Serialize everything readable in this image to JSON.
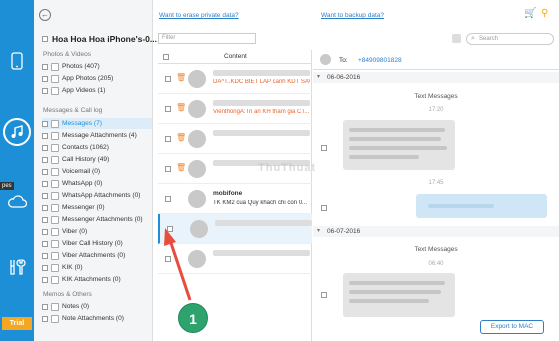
{
  "device_name": "Hoa Hoa Hoa iPhone's-0...",
  "sidebar": {
    "section_photos": "Photos & Videos",
    "section_messages": "Messages & Call log",
    "section_memos": "Memos & Others",
    "items": [
      {
        "label": "Photos (407)"
      },
      {
        "label": "App Photos (205)"
      },
      {
        "label": "App Videos (1)"
      },
      {
        "label": "Messages (7)"
      },
      {
        "label": "Message Attachments (4)"
      },
      {
        "label": "Contacts (1062)"
      },
      {
        "label": "Call History (49)"
      },
      {
        "label": "Voicemail (0)"
      },
      {
        "label": "WhatsApp (0)"
      },
      {
        "label": "WhatsApp Attachments (0)"
      },
      {
        "label": "Messenger (0)"
      },
      {
        "label": "Messenger Attachments (0)"
      },
      {
        "label": "Viber (0)"
      },
      {
        "label": "Viber Call History (0)"
      },
      {
        "label": "Viber Attachments (0)"
      },
      {
        "label": "KIK (0)"
      },
      {
        "label": "KIK Attachments (0)"
      },
      {
        "label": "Notes (0)"
      },
      {
        "label": "Note Attachments (0)"
      }
    ]
  },
  "rail": {
    "tooltip": "pes",
    "trial": "Trial"
  },
  "toolbar": {
    "link_erase": "Want to erase private data?",
    "link_backup": "Want to backup data?",
    "filter_placeholder": "Filter",
    "search_placeholder": "Search"
  },
  "list": {
    "header": "Content",
    "rows": [
      {
        "preview": "DA^T..KDC BIET LAP canh KDT SAVI..."
      },
      {
        "preview": "VienthongA:Tri an KH tham gia CT..."
      },
      {
        "preview": ""
      },
      {
        "preview": ""
      },
      {
        "name": "mobifone",
        "preview": "TK KM2 cua Quy khach chi con 0..."
      },
      {
        "preview": ""
      },
      {
        "preview": ""
      }
    ]
  },
  "conversation": {
    "to_label": "To:",
    "to_number": "+84909801828",
    "date1": "06-06-2016",
    "caption1": "Text Messages",
    "time1": "17:20",
    "time2": "17:45",
    "date2": "06-07-2016",
    "caption2": "Text Messages",
    "time3": "06:40"
  },
  "export_label": "Export to MAC",
  "watermark": "ThuThuat",
  "callout_number": "1",
  "colors": {
    "accent": "#1c8fd6",
    "trial": "#f5a623",
    "callout": "#2ea36e",
    "arrow": "#e74c3c"
  }
}
